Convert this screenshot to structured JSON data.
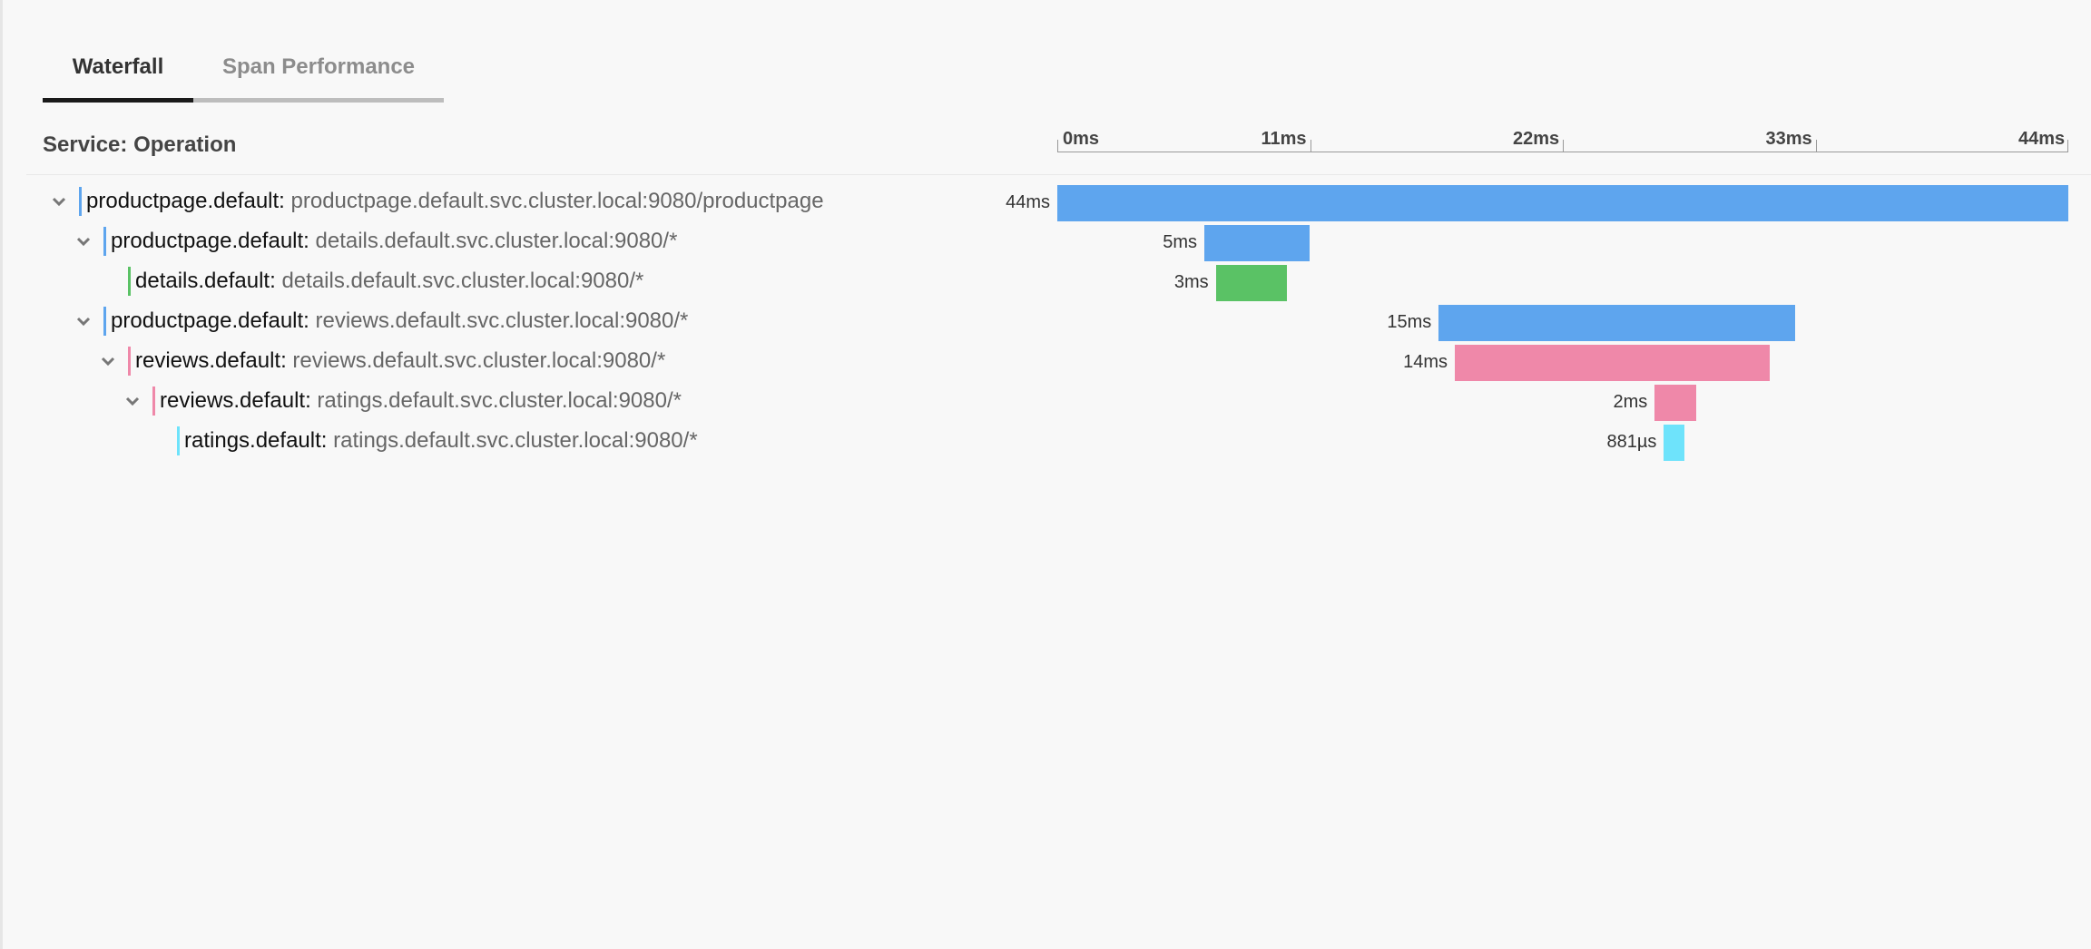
{
  "tabs": [
    {
      "label": "Waterfall",
      "active": true
    },
    {
      "label": "Span Performance",
      "active": false
    }
  ],
  "header": {
    "title": "Service: Operation"
  },
  "timeline": {
    "ticks": [
      "0ms",
      "11ms",
      "22ms",
      "33ms",
      "44ms"
    ],
    "total_ms": 44
  },
  "spans": [
    {
      "service": "productpage.default:",
      "operation": "productpage.default.svc.cluster.local:9080/productpage",
      "duration": "44ms",
      "start_ms": 0,
      "duration_ms": 44,
      "depth": 0,
      "collapsible": true,
      "color": "#5ea5ee"
    },
    {
      "service": "productpage.default:",
      "operation": "details.default.svc.cluster.local:9080/*",
      "duration": "5ms",
      "start_ms": 6.4,
      "duration_ms": 4.6,
      "depth": 1,
      "collapsible": true,
      "color": "#5ea5ee"
    },
    {
      "service": "details.default:",
      "operation": "details.default.svc.cluster.local:9080/*",
      "duration": "3ms",
      "start_ms": 6.9,
      "duration_ms": 3.1,
      "depth": 2,
      "collapsible": false,
      "color": "#5ac265"
    },
    {
      "service": "productpage.default:",
      "operation": "reviews.default.svc.cluster.local:9080/*",
      "duration": "15ms",
      "start_ms": 16.6,
      "duration_ms": 15.5,
      "depth": 1,
      "collapsible": true,
      "color": "#5ea5ee"
    },
    {
      "service": "reviews.default:",
      "operation": "reviews.default.svc.cluster.local:9080/*",
      "duration": "14ms",
      "start_ms": 17.3,
      "duration_ms": 13.7,
      "depth": 2,
      "collapsible": true,
      "color": "#ef88a9"
    },
    {
      "service": "reviews.default:",
      "operation": "ratings.default.svc.cluster.local:9080/*",
      "duration": "2ms",
      "start_ms": 26.0,
      "duration_ms": 1.8,
      "depth": 3,
      "collapsible": true,
      "color": "#ef88a9"
    },
    {
      "service": "ratings.default:",
      "operation": "ratings.default.svc.cluster.local:9080/*",
      "duration": "881µs",
      "start_ms": 26.4,
      "duration_ms": 0.881,
      "depth": 4,
      "collapsible": false,
      "color": "#6ee3fb"
    }
  ]
}
